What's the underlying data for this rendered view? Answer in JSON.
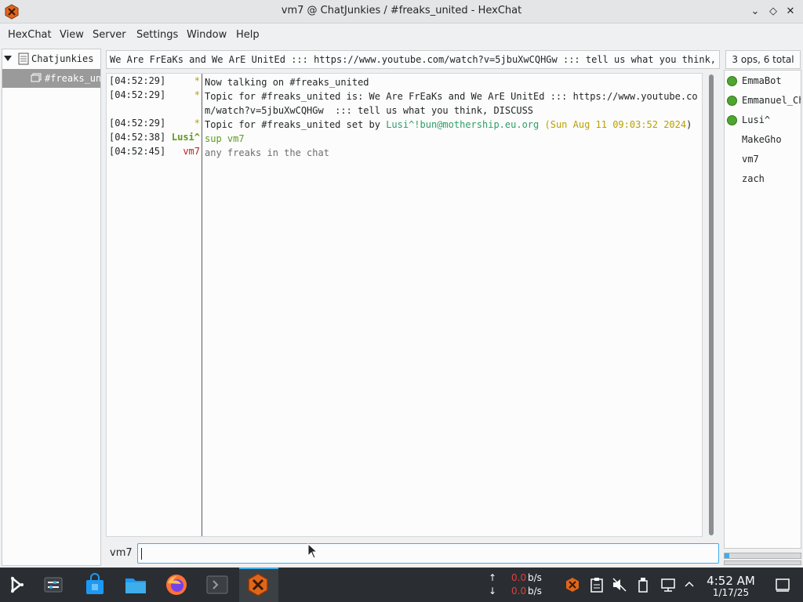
{
  "window": {
    "title": "vm7 @ ChatJunkies / #freaks_united - HexChat",
    "minimize_glyph": "⌄",
    "maximize_glyph": "◇",
    "close_glyph": "✕"
  },
  "menu": [
    "HexChat",
    "View",
    "Server",
    "Settings",
    "Window",
    "Help"
  ],
  "tree": {
    "server": "Chatjunkies",
    "channel": "#freaks_uni"
  },
  "topic_bar": "We Are FrEaKs and We ArE UnitEd ::: https://www.youtube.com/watch?v=5jbuXwCQHGw  ::: tell us what you think, DI",
  "ops_count": "3 ops, 6 total",
  "chat": {
    "lines": [
      {
        "ts": "[04:52:29]",
        "nick": "*",
        "msg": "Now talking on #freaks_united"
      },
      {
        "ts": "[04:52:29]",
        "nick": "*",
        "msg": "Topic for #freaks_united is: We Are FrEaKs and We ArE UnitEd ::: https://www.youtube.com/watch?v=5jbuXwCQHGw  ::: tell us what you think, DISCUSS"
      },
      {
        "ts": "[04:52:29]",
        "nick": "*",
        "msg_a": "Topic for #freaks_united set by ",
        "msg_b": "Lusi^!bun@mothership.eu.org",
        "msg_c": " (",
        "msg_d": "Sun Aug 11 09:03:52 2024",
        "msg_e": ")"
      },
      {
        "ts": "[04:52:38]",
        "nick": "Lusi^",
        "msg": "sup vm7"
      },
      {
        "ts": "[04:52:45]",
        "nick": "vm7",
        "msg": "any freaks in the chat"
      }
    ]
  },
  "users": [
    {
      "name": "EmmaBot",
      "op": true
    },
    {
      "name": "Emmanuel_Ch",
      "op": true
    },
    {
      "name": "Lusi^",
      "op": true
    },
    {
      "name": "MakeGho",
      "op": false
    },
    {
      "name": "vm7",
      "op": false
    },
    {
      "name": "zach",
      "op": false
    }
  ],
  "input": {
    "nick": "vm7",
    "value": ""
  },
  "taskbar": {
    "upload_arrow": "↑",
    "download_arrow": "↓",
    "upload_value": "0.0",
    "download_value": "0.0",
    "rate_unit": "b/s",
    "time": "4:52 AM",
    "date": "1/17/25"
  },
  "colors": {
    "accent": "#3daee9",
    "nick_lusi": "#5c9c1a",
    "nick_vm7": "#c02020",
    "star": "#b8a100",
    "link_green": "#2e9e66",
    "date_yellow": "#b8a100",
    "net_red": "#e04040"
  }
}
